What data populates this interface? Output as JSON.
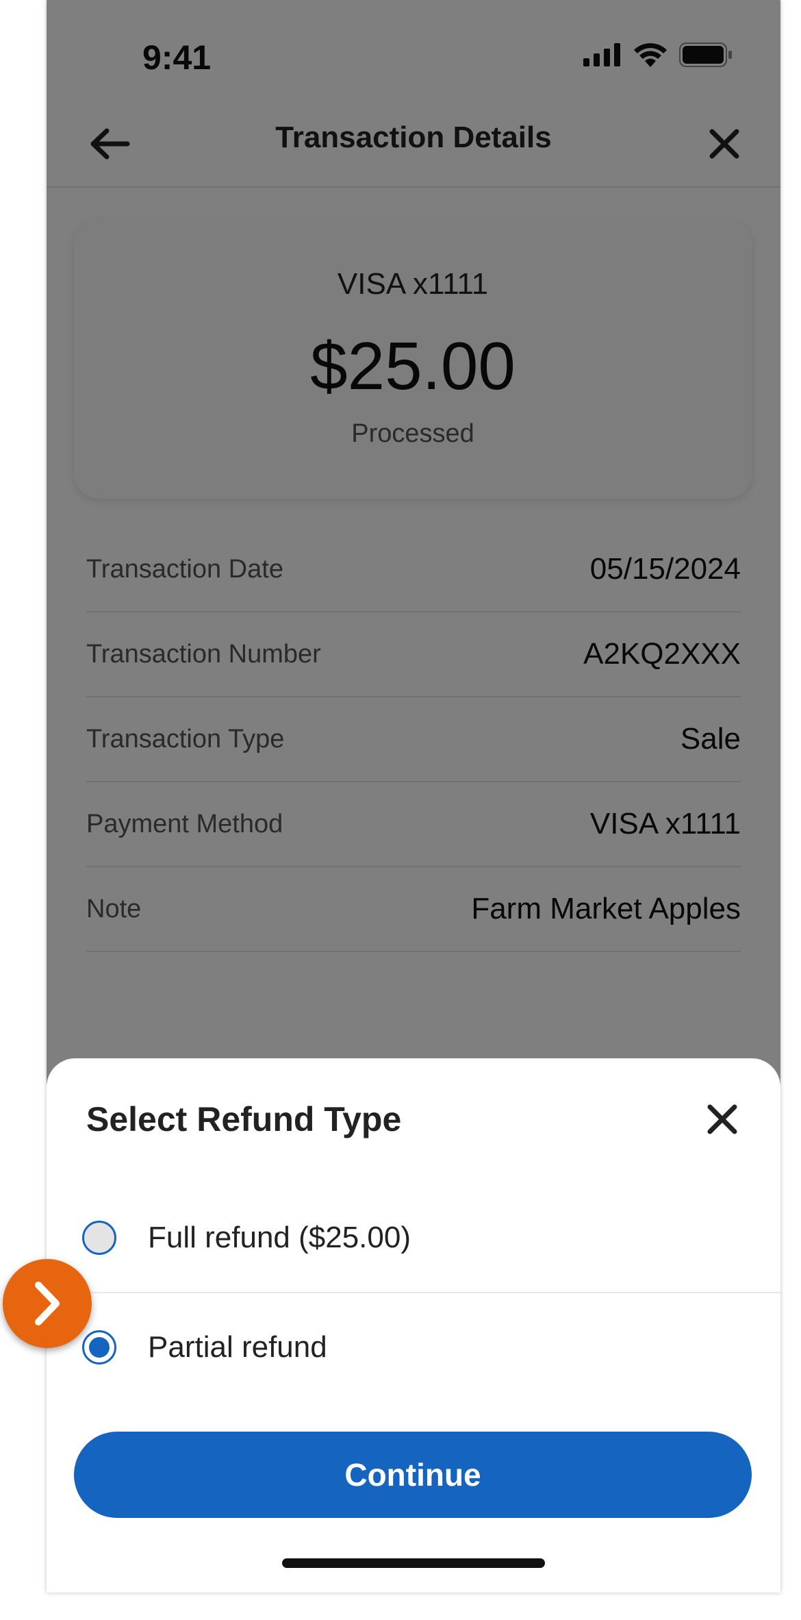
{
  "status_bar": {
    "time": "9:41"
  },
  "header": {
    "title": "Transaction Details"
  },
  "card": {
    "method": "VISA x1111",
    "amount": "$25.00",
    "status": "Processed"
  },
  "details": [
    {
      "label": "Transaction Date",
      "value": "05/15/2024"
    },
    {
      "label": "Transaction Number",
      "value": "A2KQ2XXX"
    },
    {
      "label": "Transaction Type",
      "value": "Sale"
    },
    {
      "label": "Payment Method",
      "value": "VISA x1111"
    },
    {
      "label": "Note",
      "value": "Farm Market Apples"
    }
  ],
  "refund_sheet": {
    "title": "Select Refund Type",
    "options": [
      {
        "label": "Full refund ($25.00)",
        "selected": false
      },
      {
        "label": "Partial refund",
        "selected": true
      }
    ],
    "continue_label": "Continue"
  },
  "colors": {
    "primary": "#1565c0",
    "pointer": "#e8650f",
    "overlay": "rgba(0,0,0,0.5)"
  },
  "icons": [
    "back-arrow-icon",
    "close-icon",
    "signal-icon",
    "wifi-icon",
    "battery-icon",
    "chevron-right-icon"
  ]
}
